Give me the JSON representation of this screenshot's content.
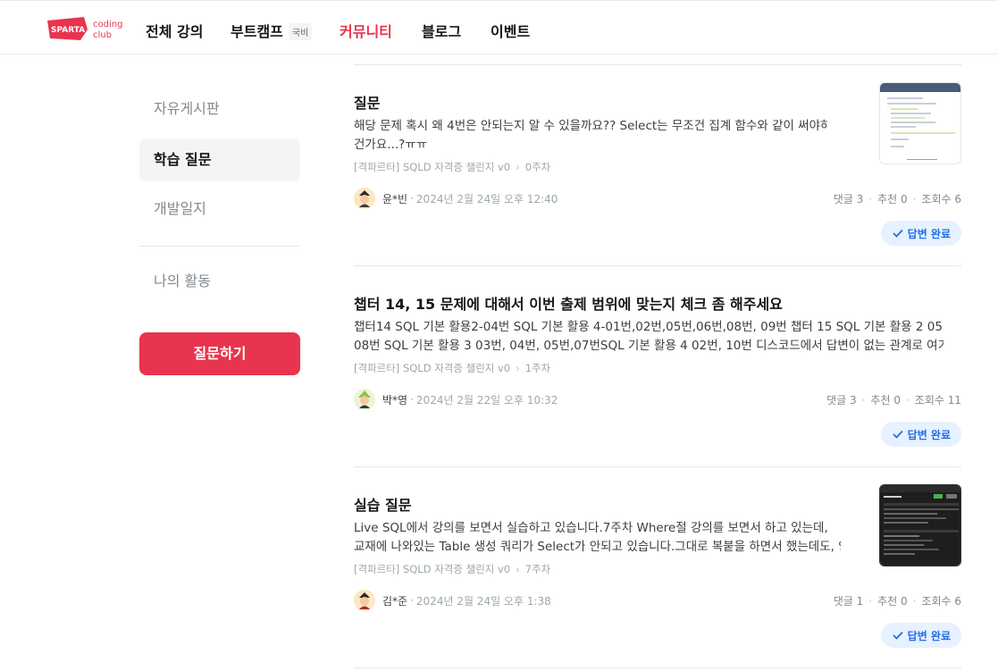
{
  "brand": {
    "logo_text": "SPARTA",
    "logo_sub": "coding club",
    "accent": "#e8344e"
  },
  "nav": [
    {
      "label": "전체 강의",
      "active": false
    },
    {
      "label": "부트캠프",
      "badge": "국비",
      "active": false
    },
    {
      "label": "커뮤니티",
      "active": true
    },
    {
      "label": "블로그",
      "active": false
    },
    {
      "label": "이벤트",
      "active": false
    }
  ],
  "sidebar": {
    "items": [
      {
        "label": "자유게시판",
        "active": false
      },
      {
        "label": "학습 질문",
        "active": true
      },
      {
        "label": "개발일지",
        "active": false
      },
      {
        "label": "나의 활동",
        "active": false
      }
    ],
    "ask_button": "질문하기"
  },
  "posts": [
    {
      "title": "질문",
      "body": [
        "해당 문제 혹시 왜 4번은 안되는지 알 수 있을까요?? Select는 무조건 집계 함수와 같이 써야하는",
        "건가요...?ㅠㅠ"
      ],
      "course": "[격파르타] SQLD 자격증 챌린지 v0",
      "week": "0주차",
      "author": "윤*빈",
      "date": "2024년 2월 24일 오후 12:40",
      "comments": "댓글 3",
      "likes": "추천 0",
      "views": "조회수 6",
      "status": "답변 완료",
      "has_thumb": true
    },
    {
      "title": "챕터 14, 15 문제에 대해서 이번 출제 범위에 맞는지 체크 좀 해주세요",
      "body": [
        "챕터14 SQL 기본 활용2-04번 SQL 기본 활용 4-01번,02번,05번,06번,08번, 09번 챕터 15 SQL 기본 활용 2 05번,",
        "08번 SQL 기본 활용 3 03번, 04번, 05번,07번SQL 기본 활용 4 02번, 10번 디스코드에서 답변이 없는 관계로 여기에..."
      ],
      "course": "[격파르타] SQLD 자격증 챌린지 v0",
      "week": "1주차",
      "author": "박*영",
      "date": "2024년 2월 22일 오후 10:32",
      "comments": "댓글 3",
      "likes": "추천 0",
      "views": "조회수 11",
      "status": "답변 완료",
      "has_thumb": false
    },
    {
      "title": "실습 질문",
      "body": [
        "Live SQL에서 강의를 보면서 실습하고 있습니다.7주차 Where절 강의를 보면서 하고 있는데,",
        "교재에 나와있는 Table 생성 쿼리가 Select가 안되고 있습니다.그대로 복붙을 하면서 했는데도, 안..."
      ],
      "course": "[격파르타] SQLD 자격증 챌린지 v0",
      "week": "7주차",
      "author": "김*준",
      "date": "2024년 2월 24일 오후 1:38",
      "comments": "댓글 1",
      "likes": "추천 0",
      "views": "조회수 6",
      "status": "답변 완료",
      "has_thumb": true
    }
  ]
}
